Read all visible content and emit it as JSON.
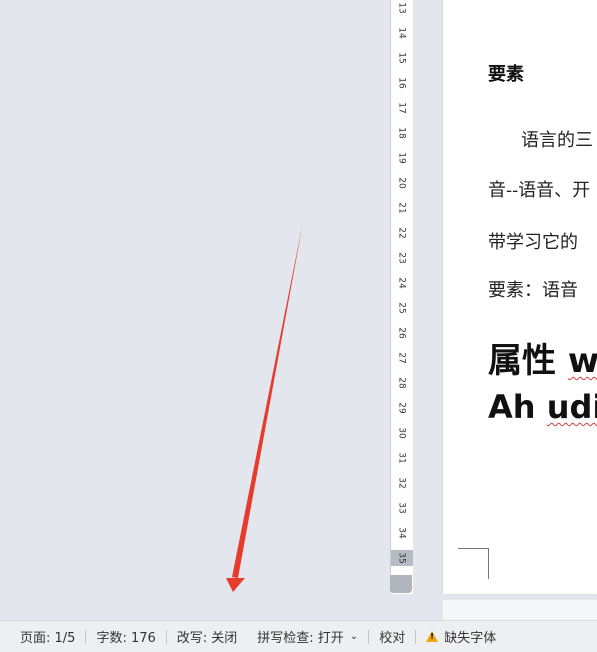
{
  "ruler": {
    "ticks": [
      "13",
      "14",
      "15",
      "16",
      "17",
      "18",
      "19",
      "20",
      "21",
      "22",
      "23",
      "24",
      "25",
      "26",
      "27",
      "28",
      "29",
      "30",
      "31",
      "32",
      "33",
      "34",
      "35"
    ],
    "active_tick": "35"
  },
  "document": {
    "heading_small": "要素",
    "paragraphs": [
      "语言的三",
      "音--语音、开",
      "带学习它的",
      "要素：语音"
    ],
    "heading_large_lines": [
      {
        "plain": "属性 ",
        "squiggle": "w"
      },
      {
        "plain": "Ah ",
        "squiggle": "udi"
      }
    ]
  },
  "statusbar": {
    "page": "页面: 1/5",
    "word_count": "字数: 176",
    "overwrite": "改写: 关闭",
    "spellcheck": "拼写检查: 打开",
    "proofread": "校对",
    "missing_fonts": "缺失字体"
  },
  "annotation": {
    "color": "#e53c2e"
  }
}
